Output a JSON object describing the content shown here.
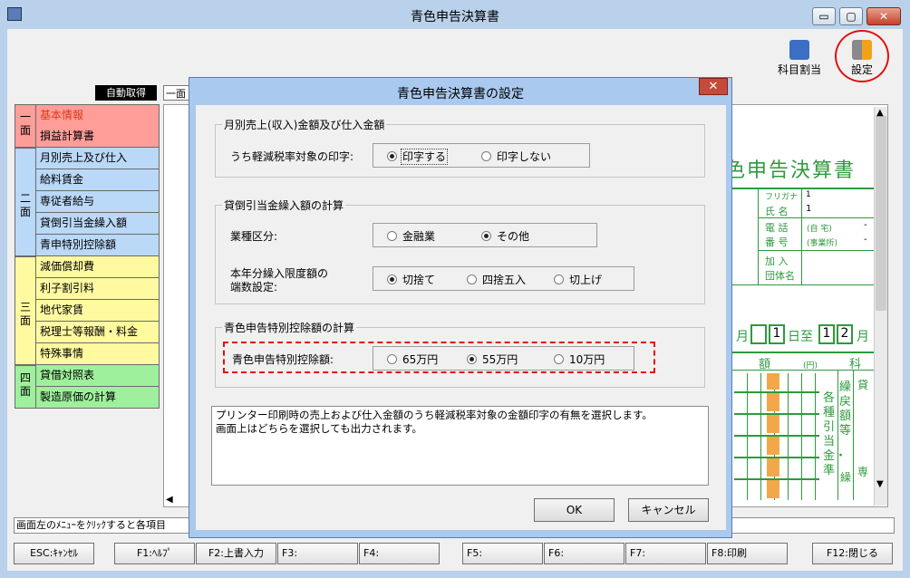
{
  "window": {
    "title": "青色申告決算書"
  },
  "titlebar_buttons": {
    "minimize": "▭",
    "maximize": "▢",
    "close": "✕"
  },
  "toolbar": {
    "account_assign": "科目割当",
    "settings": "設定"
  },
  "auto_fetch": "自動取得",
  "doc_tab": "一面",
  "nav": {
    "groups": [
      {
        "label": "一\n面",
        "color": "#ff9d99"
      },
      {
        "label": "二\n面",
        "color": "#bad8f7"
      },
      {
        "label": "三\n面",
        "color": "#fffaa0"
      },
      {
        "label": "四\n面",
        "color": "#9ff09c"
      }
    ],
    "items": [
      "基本情報",
      "損益計算書",
      "月別売上及び仕入",
      "給料賃金",
      "専従者給与",
      "貸倒引当金繰入額",
      "青申特別控除額",
      "減価償却費",
      "利子割引料",
      "地代家賃",
      "税理士等報酬・料金",
      "特殊事情",
      "貸借対照表",
      "製造原価の計算"
    ]
  },
  "doc": {
    "heading": "色申告決算書",
    "furigana": "フリガナ",
    "furigana_val": "1",
    "name": "氏 名",
    "name_val": "1",
    "phone1": "電 話",
    "phone2": "番 号",
    "phone_home": "(自 宅)",
    "phone_office": "(事業所)",
    "dash": "-",
    "assoc1": "加 入",
    "assoc2": "団体名",
    "month": "月",
    "day_to": "日至",
    "d1": "1",
    "d2": "1",
    "d3": "2",
    "month2": "月",
    "amount": "額",
    "yen": "(円)",
    "subject": "科",
    "v1": "各種引当金・準",
    "v2": "繰戻額等",
    "v3": "貸",
    "v4": "専",
    "v5": "繰"
  },
  "status_text": "画面左のﾒﾆｭｰをｸﾘｯｸすると各項目",
  "fkeys": [
    "ESC:ｷｬﾝｾﾙ",
    "F1:ﾍﾙﾌﾟ",
    "F2:上書入力",
    "F3:",
    "F4:",
    "F5:",
    "F6:",
    "F7:",
    "F8:印刷",
    "F12:閉じる"
  ],
  "dialog": {
    "title": "青色申告決算書の設定",
    "close": "✕",
    "group1": {
      "title": "月別売上(収入)金額及び仕入金額",
      "label": "うち軽減税率対象の印字:",
      "options": [
        "印字する",
        "印字しない"
      ],
      "selected": "印字する"
    },
    "group2": {
      "title": "貸倒引当金繰入額の計算",
      "label1": "業種区分:",
      "options1": [
        "金融業",
        "その他"
      ],
      "selected1": "その他",
      "label2a": "本年分繰入限度額の",
      "label2b": "端数設定:",
      "options2": [
        "切捨て",
        "四捨五入",
        "切上げ"
      ],
      "selected2": "切捨て"
    },
    "group3": {
      "title": "青色申告特別控除額の計算",
      "label": "青色申告特別控除額:",
      "options": [
        "65万円",
        "55万円",
        "10万円"
      ],
      "selected": "55万円"
    },
    "help_text": "プリンター印刷時の売上および仕入金額のうち軽減税率対象の金額印字の有無を選択します。\n画面上はどちらを選択しても出力されます。",
    "ok": "OK",
    "cancel": "キャンセル"
  }
}
